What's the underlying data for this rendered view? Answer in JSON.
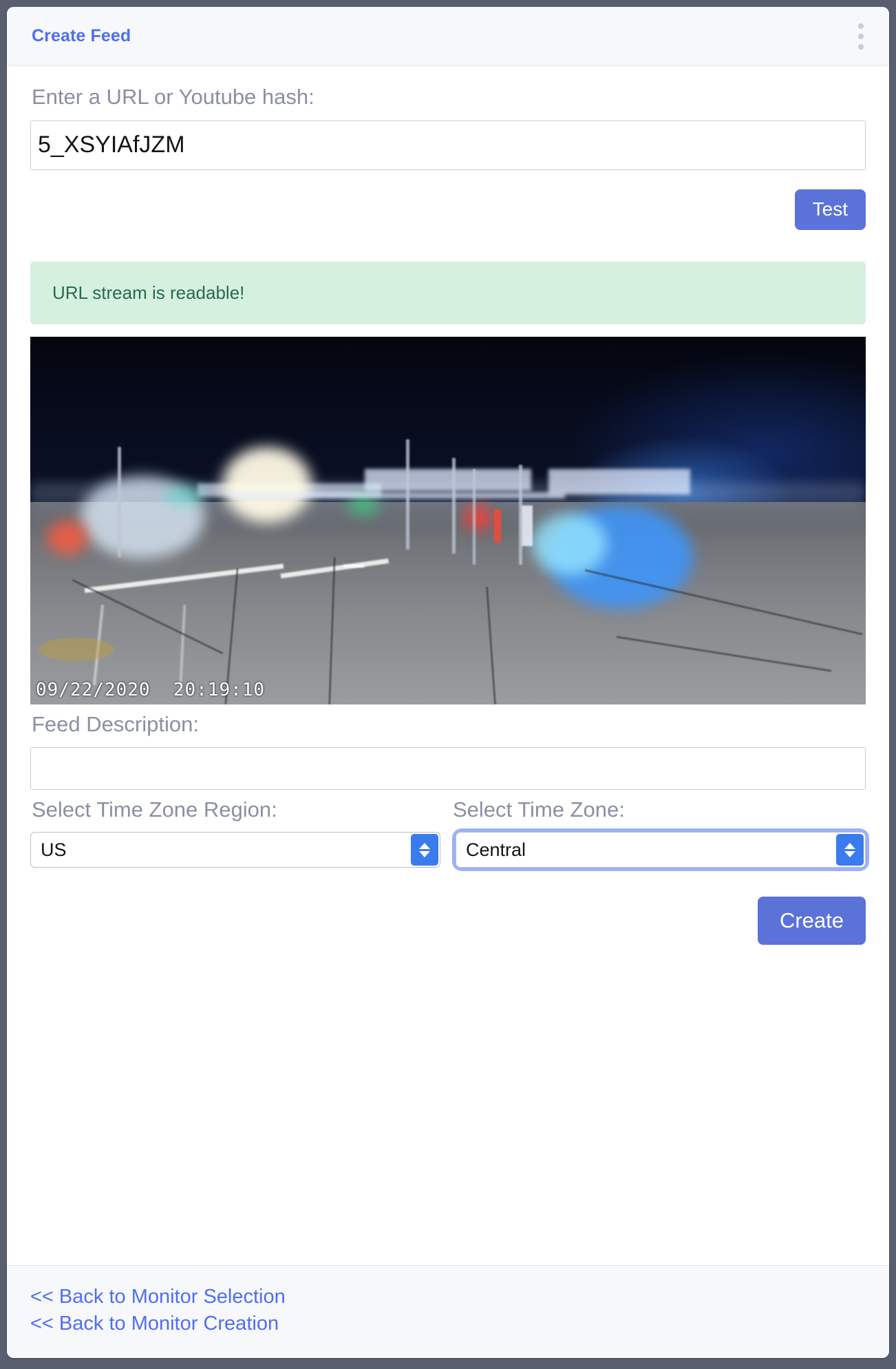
{
  "header": {
    "title": "Create Feed",
    "menu_icon": "kebab-menu-icon"
  },
  "form": {
    "url_label": "Enter a URL or Youtube hash:",
    "url_value": "5_XSYIAfJZM",
    "url_placeholder": "",
    "test_button": "Test",
    "status_message": "URL stream is readable!",
    "description_label": "Feed Description:",
    "description_value": "",
    "description_placeholder": "",
    "timezone_region_label": "Select Time Zone Region:",
    "timezone_region_value": "US",
    "timezone_label": "Select Time Zone:",
    "timezone_value": "Central",
    "create_button": "Create"
  },
  "preview": {
    "timestamp": "09/22/2020  20:19:10"
  },
  "footer": {
    "links": [
      {
        "label": "<< Back to Monitor Selection"
      },
      {
        "label": "<< Back to Monitor Creation"
      }
    ]
  },
  "colors": {
    "accent": "#4f6ef2",
    "button": "#5b73d8",
    "success_bg": "#d6f0e0",
    "success_text": "#2a6b47",
    "label": "#8b8fa3",
    "page_bg": "#5a5f70"
  }
}
